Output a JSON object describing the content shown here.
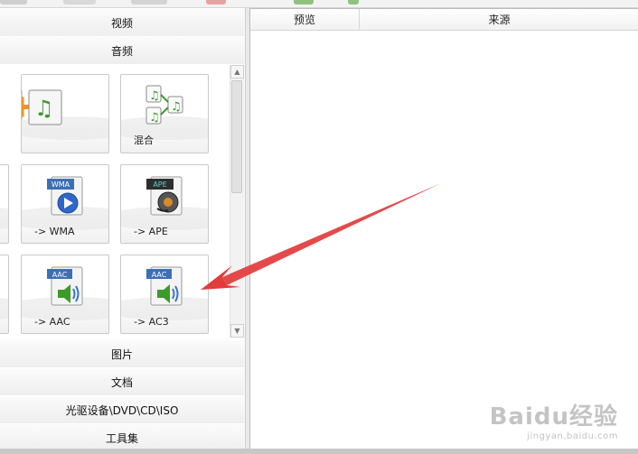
{
  "categories": {
    "video": "视频",
    "audio": "音频",
    "image": "图片",
    "document": "文档",
    "disc": "光驱设备\\DVD\\CD\\ISO",
    "tools": "工具集"
  },
  "tiles": [
    {
      "id": "merge-tile",
      "label": "",
      "icon": "audio-merge-icon"
    },
    {
      "id": "mix-tile",
      "label": "混合",
      "icon": "audio-mix-icon"
    },
    {
      "id": "wma-tile",
      "label": "-> WMA",
      "icon": "wma-file-icon",
      "badge": "WMA"
    },
    {
      "id": "ape-tile",
      "label": "-> APE",
      "icon": "ape-file-icon",
      "badge": "APE"
    },
    {
      "id": "aac-tile",
      "label": "-> AAC",
      "icon": "aac-file-icon",
      "badge": "AAC"
    },
    {
      "id": "ac3-tile",
      "label": "-> AC3",
      "icon": "ac3-file-icon",
      "badge": "AAC"
    }
  ],
  "file_list": {
    "columns": [
      "预览",
      "来源"
    ]
  },
  "watermark": {
    "main": "Baidu经验",
    "sub": "jingyan.baidu.com"
  },
  "colors": {
    "annotation_arrow": "#e23b3b",
    "music_note_green": "#3d9a2a",
    "badge_blue": "#3d6fb5",
    "plus_orange": "#f29322"
  }
}
